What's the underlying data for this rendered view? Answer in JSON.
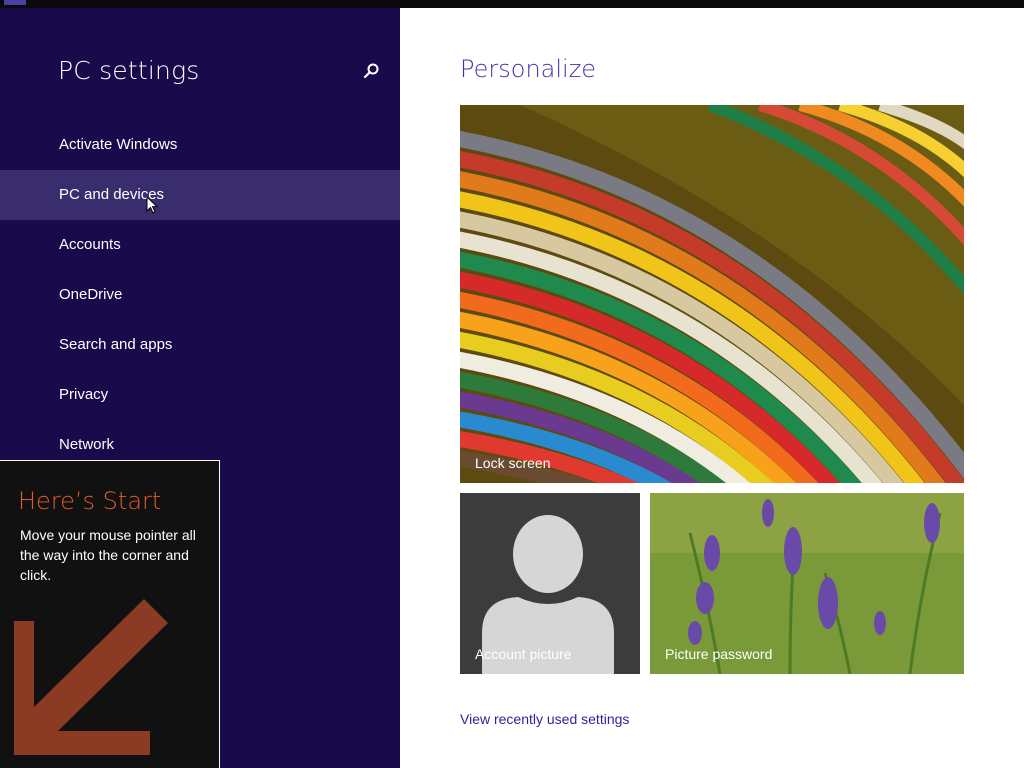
{
  "sidebar": {
    "title": "PC settings",
    "search_icon": "search-icon",
    "items": [
      {
        "label": "Activate Windows"
      },
      {
        "label": "PC and devices"
      },
      {
        "label": "Accounts"
      },
      {
        "label": "OneDrive"
      },
      {
        "label": "Search and apps"
      },
      {
        "label": "Privacy"
      },
      {
        "label": "Network"
      }
    ],
    "hovered_item": "PC and devices"
  },
  "tip": {
    "title": "Here’s Start",
    "body": "Move your mouse pointer all the way into the corner and click.",
    "arrow_icon": "arrow-down-left-icon"
  },
  "main": {
    "title": "Personalize",
    "tiles": {
      "lock_screen": "Lock screen",
      "account_picture": "Account picture",
      "picture_password": "Picture password"
    },
    "recent_link": "View recently used settings"
  },
  "colors": {
    "sidebar_bg": "#180a4b",
    "accent_purple": "#4b2ea8",
    "tip_orange": "#e4592b",
    "tip_arrow": "#8b3a24"
  }
}
